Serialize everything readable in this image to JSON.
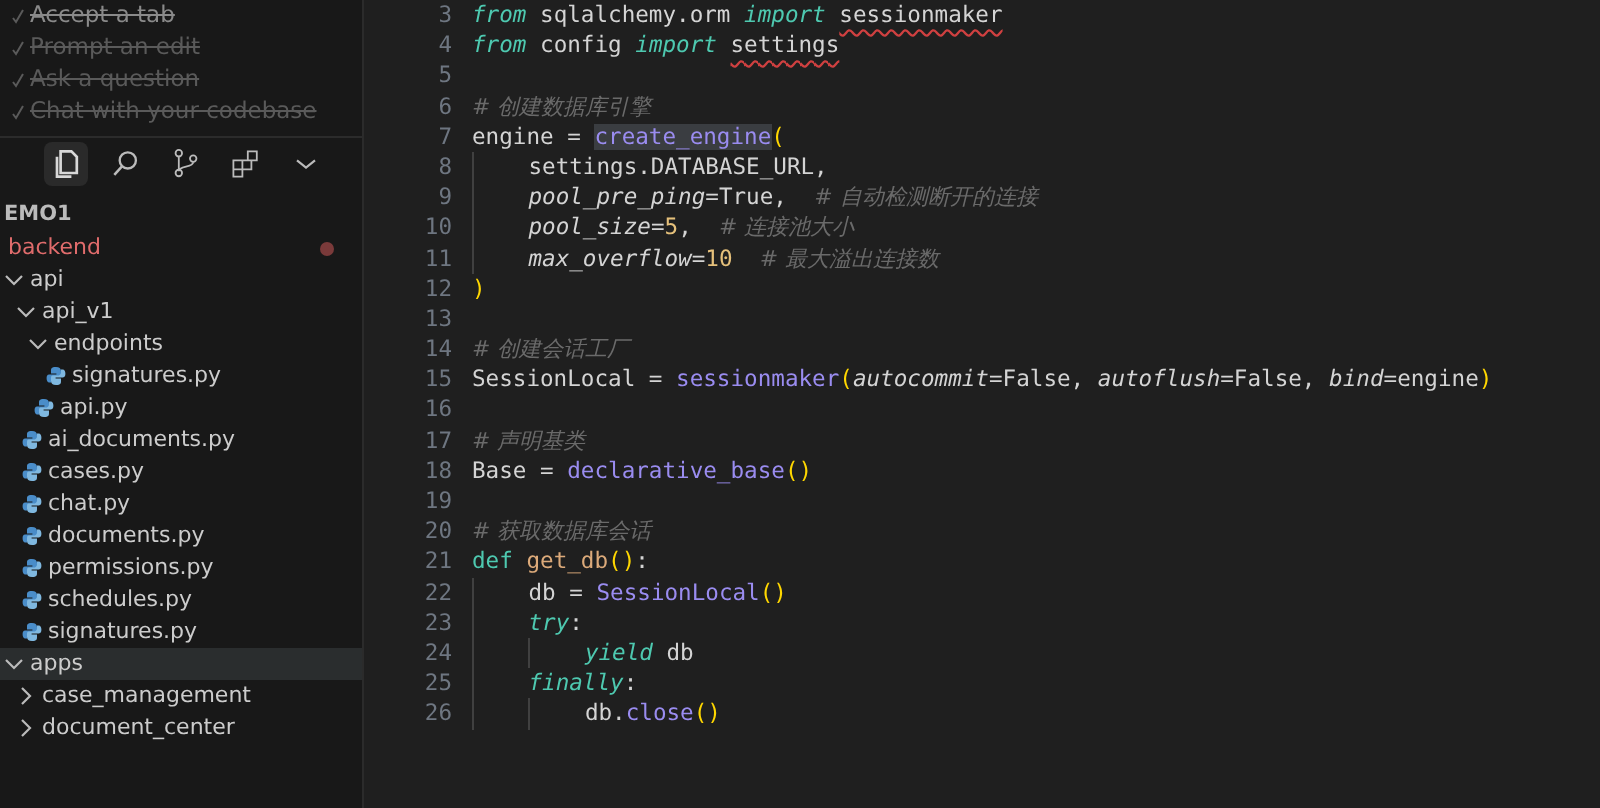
{
  "checklist": [
    {
      "label": "Accept a tab",
      "done": true
    },
    {
      "label": "Prompt an edit",
      "done": true
    },
    {
      "label": "Ask a question",
      "done": true
    },
    {
      "label": "Chat with your codebase",
      "done": true
    }
  ],
  "activity_bar": [
    {
      "kind": "files",
      "selected": true
    },
    {
      "kind": "search",
      "selected": false
    },
    {
      "kind": "source-control",
      "selected": false
    },
    {
      "kind": "extensions",
      "selected": false
    },
    {
      "kind": "more",
      "selected": false
    }
  ],
  "explorer": {
    "workspace": "EMO1",
    "root": {
      "label": "backend",
      "modified": true
    },
    "tree": [
      {
        "label": "api",
        "kind": "folder",
        "expanded": true,
        "selected": false,
        "children": [
          {
            "label": "api_v1",
            "kind": "folder",
            "expanded": true,
            "selected": false,
            "children": [
              {
                "label": "endpoints",
                "kind": "folder",
                "expanded": true,
                "selected": false,
                "children": [
                  {
                    "label": "signatures.py",
                    "kind": "python",
                    "selected": false
                  }
                ]
              },
              {
                "label": "api.py",
                "kind": "python",
                "selected": false
              }
            ]
          },
          {
            "label": "ai_documents.py",
            "kind": "python",
            "selected": false
          },
          {
            "label": "cases.py",
            "kind": "python",
            "selected": false
          },
          {
            "label": "chat.py",
            "kind": "python",
            "selected": false
          },
          {
            "label": "documents.py",
            "kind": "python",
            "selected": false
          },
          {
            "label": "permissions.py",
            "kind": "python",
            "selected": false
          },
          {
            "label": "schedules.py",
            "kind": "python",
            "selected": false
          },
          {
            "label": "signatures.py",
            "kind": "python",
            "selected": false
          }
        ]
      },
      {
        "label": "apps",
        "kind": "folder",
        "expanded": true,
        "selected": true,
        "children": [
          {
            "label": "case_management",
            "kind": "folder",
            "expanded": false,
            "selected": false
          },
          {
            "label": "document_center",
            "kind": "folder",
            "expanded": false,
            "selected": false
          }
        ]
      }
    ]
  },
  "editor": {
    "lines": [
      {
        "number": "3",
        "tokens": [
          {
            "kind": "keyword",
            "text": "from"
          },
          {
            "kind": "plain",
            "text": " sqlalchemy.orm "
          },
          {
            "kind": "keyword",
            "text": "import "
          },
          {
            "kind": "plain",
            "text": "sessionmaker",
            "squiggle": true
          }
        ]
      },
      {
        "number": "4",
        "tokens": [
          {
            "kind": "keyword",
            "text": "from"
          },
          {
            "kind": "plain",
            "text": " config "
          },
          {
            "kind": "keyword",
            "text": "import "
          },
          {
            "kind": "plain",
            "text": "settings",
            "squiggle": true
          }
        ]
      },
      {
        "number": "5"
      },
      {
        "number": "6",
        "tokens": [
          {
            "kind": "comment",
            "text": "# 创建数据库引擎"
          }
        ]
      },
      {
        "number": "7",
        "tokens": [
          {
            "kind": "plain",
            "text": "engine = "
          },
          {
            "kind": "function",
            "text": "create_engine",
            "highlight": true
          },
          {
            "kind": "paren",
            "text": "("
          }
        ]
      },
      {
        "number": "8",
        "tokens": [
          {
            "kind": "plain",
            "text": "    settings.DATABASE_URL,"
          }
        ]
      },
      {
        "number": "9",
        "tokens": [
          {
            "kind": "param",
            "text": "    pool_pre_ping"
          },
          {
            "kind": "plain",
            "text": "=True,  "
          },
          {
            "kind": "comment",
            "text": "# 自动检测断开的连接"
          }
        ]
      },
      {
        "number": "10",
        "tokens": [
          {
            "kind": "param",
            "text": "    pool_size"
          },
          {
            "kind": "plain",
            "text": "="
          },
          {
            "kind": "number",
            "text": "5"
          },
          {
            "kind": "plain",
            "text": ",  "
          },
          {
            "kind": "comment",
            "text": "# 连接池大小"
          }
        ]
      },
      {
        "number": "11",
        "tokens": [
          {
            "kind": "param",
            "text": "    max_overflow"
          },
          {
            "kind": "plain",
            "text": "="
          },
          {
            "kind": "number",
            "text": "10  "
          },
          {
            "kind": "comment",
            "text": "# 最大溢出连接数"
          }
        ]
      },
      {
        "number": "12",
        "tokens": [
          {
            "kind": "paren",
            "text": ")"
          }
        ]
      },
      {
        "number": "13"
      },
      {
        "number": "14",
        "tokens": [
          {
            "kind": "comment",
            "text": "# 创建会话工厂"
          }
        ]
      },
      {
        "number": "15",
        "tokens": [
          {
            "kind": "plain",
            "text": "SessionLocal = "
          },
          {
            "kind": "function",
            "text": "sessionmaker"
          },
          {
            "kind": "paren",
            "text": "("
          },
          {
            "kind": "param",
            "text": "autocommit"
          },
          {
            "kind": "plain",
            "text": "=False, "
          },
          {
            "kind": "param",
            "text": "autoflush"
          },
          {
            "kind": "plain",
            "text": "=False, "
          },
          {
            "kind": "param",
            "text": "bind"
          },
          {
            "kind": "plain",
            "text": "=engine"
          },
          {
            "kind": "paren",
            "text": ")"
          }
        ]
      },
      {
        "number": "16"
      },
      {
        "number": "17",
        "tokens": [
          {
            "kind": "comment",
            "text": "# 声明基类"
          }
        ]
      },
      {
        "number": "18",
        "tokens": [
          {
            "kind": "plain",
            "text": "Base = "
          },
          {
            "kind": "function",
            "text": "declarative_base"
          },
          {
            "kind": "paren",
            "text": "()"
          }
        ]
      },
      {
        "number": "19"
      },
      {
        "number": "20",
        "tokens": [
          {
            "kind": "comment",
            "text": "# 获取数据库会话"
          }
        ]
      },
      {
        "number": "21",
        "tokens": [
          {
            "kind": "storage",
            "text": "def "
          },
          {
            "kind": "defname",
            "text": "get_db"
          },
          {
            "kind": "paren",
            "text": "()"
          },
          {
            "kind": "plain",
            "text": ":"
          }
        ]
      },
      {
        "number": "22",
        "tokens": [
          {
            "kind": "plain",
            "text": "    db = "
          },
          {
            "kind": "function",
            "text": "SessionLocal"
          },
          {
            "kind": "paren",
            "text": "()"
          }
        ]
      },
      {
        "number": "23",
        "tokens": [
          {
            "kind": "keyword",
            "text": "    try"
          },
          {
            "kind": "plain",
            "text": ":"
          }
        ]
      },
      {
        "number": "24",
        "tokens": [
          {
            "kind": "keyword",
            "text": "        yield"
          },
          {
            "kind": "plain",
            "text": " db"
          }
        ]
      },
      {
        "number": "25",
        "tokens": [
          {
            "kind": "keyword",
            "text": "    finally"
          },
          {
            "kind": "plain",
            "text": ":"
          }
        ]
      },
      {
        "number": "26",
        "tokens": [
          {
            "kind": "plain",
            "text": "        db."
          },
          {
            "kind": "function",
            "text": "close"
          },
          {
            "kind": "paren",
            "text": "()"
          }
        ]
      }
    ]
  }
}
